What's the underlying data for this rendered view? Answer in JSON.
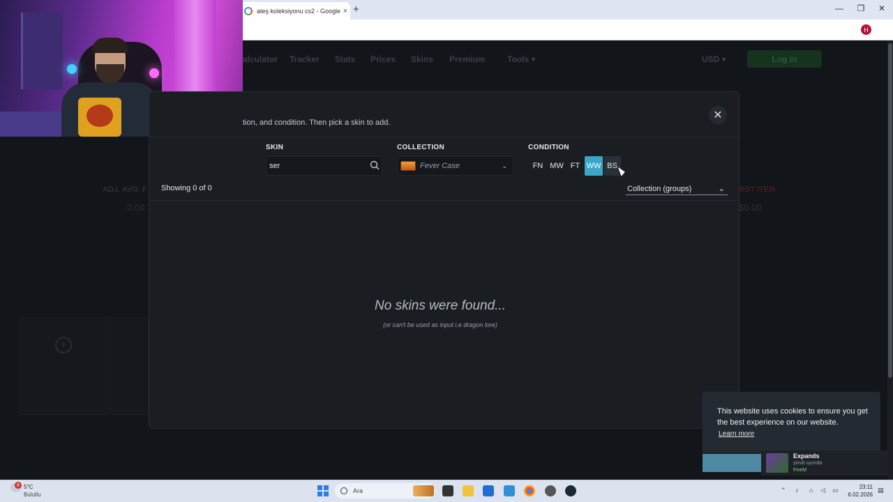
{
  "browser": {
    "tab_title": "ateş koleksiyonu cs2 - Google'",
    "tab_close": "×",
    "new_tab": "+",
    "win_min": "—",
    "win_max": "❐",
    "win_close": "✕",
    "avatar_letter": "H"
  },
  "site": {
    "nav": [
      "alculator",
      "Tracker",
      "Stats",
      "Prices",
      "Skins",
      "Premium",
      "Tools ▾"
    ],
    "currency": "USD ▾",
    "login_label": "Log in",
    "bg_stats": {
      "left_label": "ADJ. AVG. F",
      "left_value": "0.00",
      "right_label": "RST ITEM",
      "right_value": "$0.00"
    }
  },
  "modal": {
    "subtitle": "tion, and condition. Then pick a skin to add.",
    "close_label": "✕",
    "skin_label": "SKIN",
    "skin_value": "ser",
    "collection_label": "COLLECTION",
    "collection_value": "Fever Case",
    "condition_label": "CONDITION",
    "conditions": [
      "FN",
      "MW",
      "FT",
      "WW",
      "BS"
    ],
    "active_condition": "WW",
    "showing": "Showing 0 of 0",
    "sort_value": "Collection (groups)",
    "empty_title": "No skins were found...",
    "empty_subtitle": "(or can't be used as input i.e dragon lore)"
  },
  "cookie": {
    "text": "This website uses cookies to ensure you get the best experience on our website.",
    "learn_more": "Learn more"
  },
  "toast": {
    "title": "Expands",
    "subtitle": "şimdi oyunda",
    "game": "FiveM"
  },
  "taskbar": {
    "weather_badge": "8",
    "temperature": "5°C",
    "weather_desc": "Bulutlu",
    "search_placeholder": "Ara",
    "time": "23:11",
    "date": "6.02.2026"
  },
  "colors": {
    "accent": "#3aa7c8",
    "modal_bg": "#1a1e23",
    "page_bg": "#121519",
    "cookie_btn": "#4e8aa3"
  }
}
